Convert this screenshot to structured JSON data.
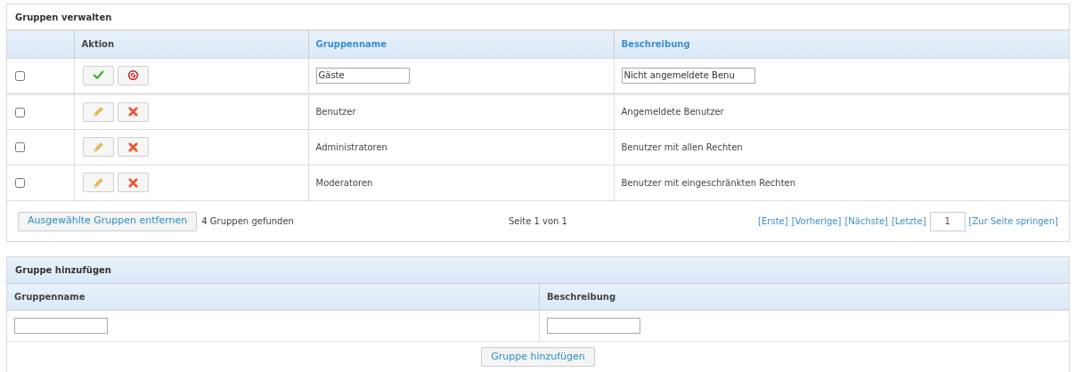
{
  "groups_panel": {
    "title": "Gruppen verwalten",
    "columns": [
      {
        "label": "Aktion",
        "sortable": false
      },
      {
        "label": "Gruppenname",
        "sortable": true
      },
      {
        "label": "Beschreibung",
        "sortable": true
      }
    ],
    "rows": [
      {
        "kind": "edit",
        "checked": false,
        "name": "Gäste",
        "description": "Nicht angemeldete Benu"
      },
      {
        "kind": "view",
        "checked": false,
        "name": "Benutzer",
        "description": "Angemeldete Benutzer"
      },
      {
        "kind": "view",
        "checked": false,
        "name": "Administratoren",
        "description": "Benutzer mit allen Rechten"
      },
      {
        "kind": "view",
        "checked": false,
        "name": "Moderatoren",
        "description": "Benutzer mit eingeschränkten Rechten"
      }
    ],
    "remove_button": "Ausgewählte Gruppen entfernen",
    "count": "4 Gruppen gefunden",
    "page_info": "Seite 1 von 1",
    "pager_links": [
      "[Erste]",
      "[Vorherige]",
      "[Nächste]",
      "[Letzte]"
    ],
    "page_input": "1",
    "jump_link": "[Zur Seite springen]"
  },
  "add_panel": {
    "title": "Gruppe hinzufügen",
    "fields": [
      {
        "label": "Gruppenname"
      },
      {
        "label": "Beschreibung"
      }
    ],
    "submit_button": "Gruppe hinzufügen"
  }
}
